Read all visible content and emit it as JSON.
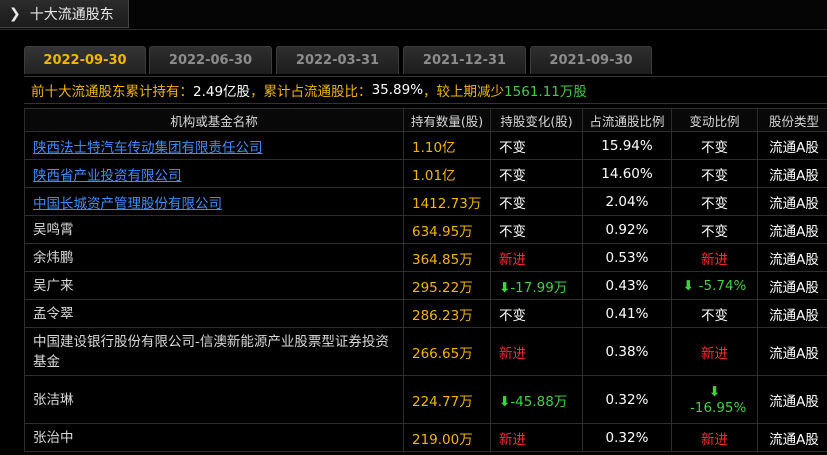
{
  "header": {
    "title": "十大流通股东",
    "expand_icon": "chevron-right-icon"
  },
  "tabs": [
    {
      "label": "2022-09-30",
      "active": true
    },
    {
      "label": "2022-06-30",
      "active": false
    },
    {
      "label": "2022-03-31",
      "active": false
    },
    {
      "label": "2021-12-31",
      "active": false
    },
    {
      "label": "2021-09-30",
      "active": false
    }
  ],
  "summary": {
    "p1": "前十大流通股东累计持有：",
    "v1": "2.49亿股",
    "p2": "，累计占流通股比：",
    "v2": "35.89%",
    "p3": "，较上期减少",
    "v3": "1561.11万股"
  },
  "table": {
    "columns": [
      "机构或基金名称",
      "持有数量(股)",
      "持股变化(股)",
      "占流通股比例",
      "变动比例",
      "股份类型"
    ],
    "rows": [
      {
        "name": "陕西法士特汽车传动集团有限责任公司",
        "link": true,
        "amount": "1.10亿",
        "change": "不变",
        "change_type": "same",
        "ratio": "15.94%",
        "change_ratio": "不变",
        "change_ratio_type": "same",
        "type": "流通A股"
      },
      {
        "name": "陕西省产业投资有限公司",
        "link": true,
        "amount": "1.01亿",
        "change": "不变",
        "change_type": "same",
        "ratio": "14.60%",
        "change_ratio": "不变",
        "change_ratio_type": "same",
        "type": "流通A股"
      },
      {
        "name": "中国长城资产管理股份有限公司",
        "link": true,
        "amount": "1412.73万",
        "change": "不变",
        "change_type": "same",
        "ratio": "2.04%",
        "change_ratio": "不变",
        "change_ratio_type": "same",
        "type": "流通A股"
      },
      {
        "name": "吴鸣霄",
        "link": false,
        "amount": "634.95万",
        "change": "不变",
        "change_type": "same",
        "ratio": "0.92%",
        "change_ratio": "不变",
        "change_ratio_type": "same",
        "type": "流通A股"
      },
      {
        "name": "余炜鹏",
        "link": false,
        "amount": "364.85万",
        "change": "新进",
        "change_type": "new",
        "ratio": "0.53%",
        "change_ratio": "新进",
        "change_ratio_type": "new",
        "type": "流通A股"
      },
      {
        "name": "吴广来",
        "link": false,
        "amount": "295.22万",
        "change": "-17.99万",
        "change_type": "down",
        "ratio": "0.43%",
        "change_ratio": "-5.74%",
        "change_ratio_type": "down",
        "type": "流通A股"
      },
      {
        "name": "孟令翠",
        "link": false,
        "amount": "286.23万",
        "change": "不变",
        "change_type": "same",
        "ratio": "0.41%",
        "change_ratio": "不变",
        "change_ratio_type": "same",
        "type": "流通A股"
      },
      {
        "name": "中国建设银行股份有限公司-信澳新能源产业股票型证券投资基金",
        "link": false,
        "tall": true,
        "amount": "266.65万",
        "change": "新进",
        "change_type": "new",
        "ratio": "0.38%",
        "change_ratio": "新进",
        "change_ratio_type": "new",
        "type": "流通A股"
      },
      {
        "name": "张洁琳",
        "link": false,
        "tall": true,
        "amount": "224.77万",
        "change": "-45.88万",
        "change_type": "down",
        "ratio": "0.32%",
        "change_ratio": "-16.95%",
        "change_ratio_type": "down",
        "type": "流通A股"
      },
      {
        "name": "张治中",
        "link": false,
        "amount": "219.00万",
        "change": "新进",
        "change_type": "new",
        "ratio": "0.32%",
        "change_ratio": "新进",
        "change_ratio_type": "new",
        "type": "流通A股"
      }
    ]
  },
  "colors": {
    "accent": "#f5b400",
    "link": "#3c8cff",
    "up_new": "#ff2a2a",
    "down": "#40d040",
    "background": "#000000"
  }
}
